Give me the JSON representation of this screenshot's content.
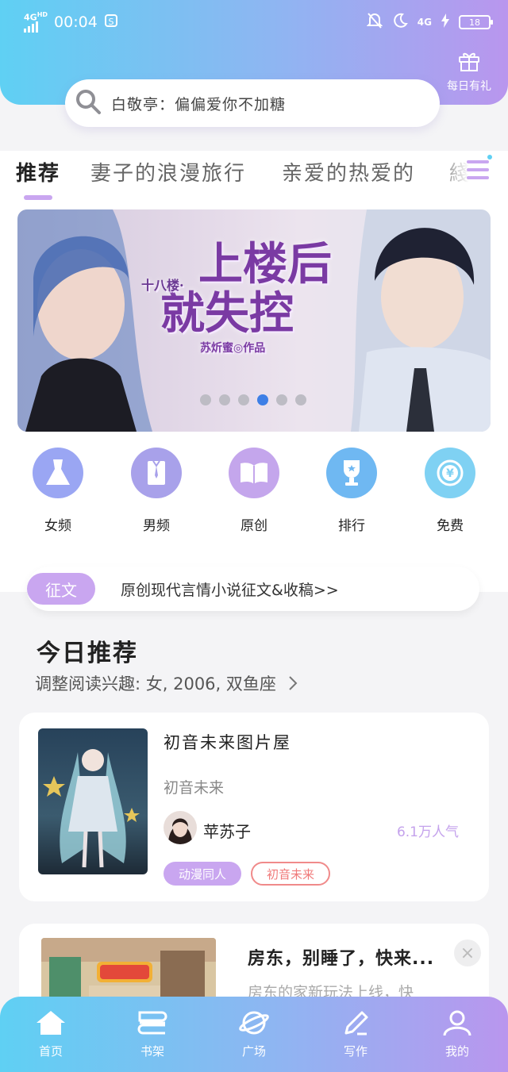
{
  "colors": {
    "accent": "#c9a6f0",
    "gradient_start": "#5fd0f3",
    "gradient_end": "#b996ee",
    "active_dot": "#3d7fe6"
  },
  "status_bar": {
    "network": "4G",
    "network_sup": "HD",
    "time": "00:04",
    "data_label": "4G",
    "battery": "18"
  },
  "header": {
    "daily_gift_label": "每日有礼"
  },
  "search": {
    "placeholder": "白敬亭：偏偏爱你不加糖"
  },
  "tabs": [
    {
      "label": "推荐"
    },
    {
      "label": "妻子的浪漫旅行"
    },
    {
      "label": "亲爱的热爱的"
    },
    {
      "label": "綫"
    }
  ],
  "banner": {
    "title_line1": "上楼后",
    "title_line2": "就失控",
    "prefix": "十八楼·",
    "author": "苏炘蜜◎作品",
    "slide_count": 6,
    "active_slide": 4
  },
  "categories": [
    {
      "label": "女频",
      "icon": "dress-icon"
    },
    {
      "label": "男频",
      "icon": "shirt-icon"
    },
    {
      "label": "原创",
      "icon": "book-icon"
    },
    {
      "label": "排行",
      "icon": "trophy-icon"
    },
    {
      "label": "免费",
      "icon": "yen-coin-icon"
    }
  ],
  "notice": {
    "badge": "征文",
    "text": "原创现代言情小说征文&收稿>>"
  },
  "today": {
    "title": "今日推荐",
    "subtitle": "调整阅读兴趣: 女, 2006, 双鱼座"
  },
  "books": [
    {
      "title": "初音未来图片屋",
      "subtitle": "初音未来",
      "author": "苹苏子",
      "popularity": "6.1万人气",
      "tags": [
        "动漫同人",
        "初音未来"
      ]
    },
    {
      "title": "房东，别睡了，快来...",
      "subtitle": "房东的家新玩法上线，快"
    }
  ],
  "bottom_nav": [
    {
      "label": "首页",
      "icon": "home-icon"
    },
    {
      "label": "书架",
      "icon": "bookshelf-icon"
    },
    {
      "label": "广场",
      "icon": "planet-icon"
    },
    {
      "label": "写作",
      "icon": "pen-icon"
    },
    {
      "label": "我的",
      "icon": "user-icon"
    }
  ]
}
